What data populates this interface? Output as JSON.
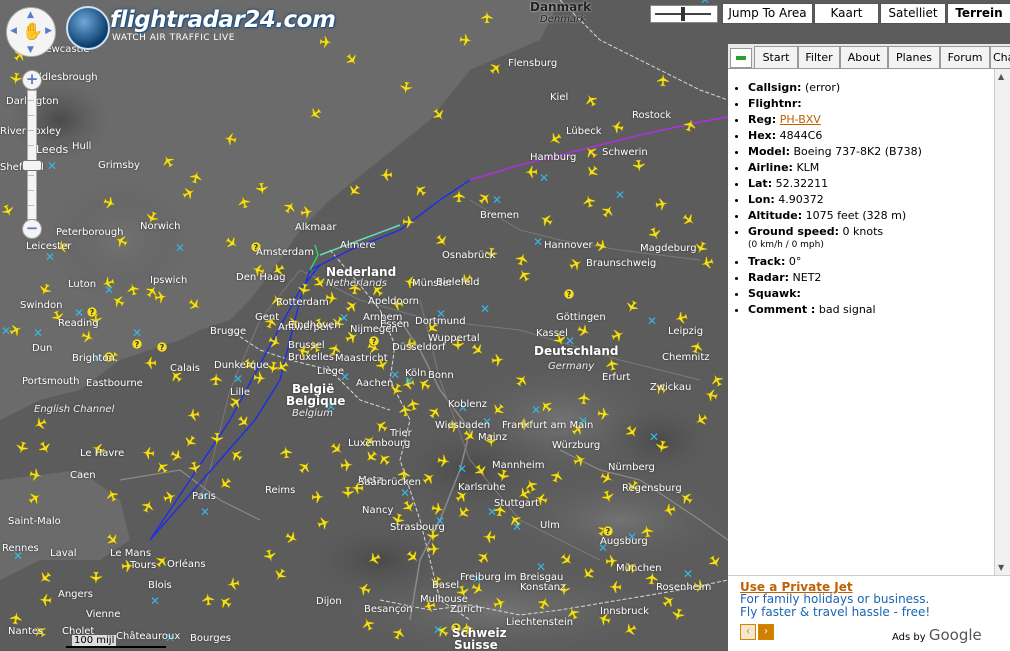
{
  "app": {
    "logo_text": "flightradar24.com",
    "tagline": "WATCH AIR TRAFFIC LIVE"
  },
  "controls": {
    "jump_label": "Jump To Area",
    "map_types": [
      "Kaart",
      "Satelliet",
      "Terrein"
    ],
    "active_map_type": "Terrein",
    "zoom_plus": "+",
    "zoom_minus": "−",
    "scale_label": "100 mijl"
  },
  "tabs": [
    "Start",
    "Filter",
    "About",
    "Planes",
    "Forum",
    "Chat"
  ],
  "flight": {
    "fields": [
      {
        "label": "Callsign:",
        "value": "(error)"
      },
      {
        "label": "Flightnr:",
        "value": ""
      },
      {
        "label": "Reg:",
        "value": "PH-BXV",
        "link": true
      },
      {
        "label": "Hex:",
        "value": "4844C6"
      },
      {
        "label": "Model:",
        "value": "Boeing 737-8K2 (B738)"
      },
      {
        "label": "Airline:",
        "value": "KLM"
      },
      {
        "label": "Lat:",
        "value": "52.32211"
      },
      {
        "label": "Lon:",
        "value": "4.90372"
      },
      {
        "label": "Altitude:",
        "value": "1075 feet (328 m)"
      },
      {
        "label": "Ground speed:",
        "value": "0 knots",
        "sub": "(0 km/h / 0 mph)"
      },
      {
        "label": "Track:",
        "value": "0°"
      },
      {
        "label": "Radar:",
        "value": "NET2"
      },
      {
        "label": "Squawk:",
        "value": ""
      },
      {
        "label": "Comment :",
        "value": "bad signal"
      }
    ]
  },
  "ad": {
    "title": "Use a Private Jet",
    "text": "For family holidays or business. Fly faster & travel hassle - free!",
    "by": "Ads by",
    "brand": "Google"
  },
  "colors": {
    "plane": "#f5e020",
    "track_blue": "#2030e0",
    "track_purple": "#b030e0",
    "track_cyan": "#60e0c0",
    "panel_link": "#c06000",
    "ad_text": "#1a66b0"
  },
  "map": {
    "countries": [
      "Nederland",
      "Netherlands",
      "België",
      "Belgique",
      "Belgium",
      "Luxembourg",
      "Deutschland",
      "Germany",
      "Danmark",
      "Denmark"
    ],
    "cities": [
      "Newcastle",
      "Middlesbrough",
      "Darlington",
      "River Loxley",
      "Leeds",
      "Sheffield",
      "Hull",
      "Grimsby",
      "Peterborough",
      "Norwich",
      "Ipswich",
      "Leicester",
      "Luton",
      "Swindon",
      "Dun",
      "Reading",
      "Brighton",
      "Portsmouth",
      "Eastbourne",
      "English Channel",
      "Le Havre",
      "Caen",
      "Saint-Malo",
      "Rennes",
      "Laval",
      "Le Mans",
      "Angers",
      "Nantes",
      "Cholet",
      "Vienne",
      "Tours",
      "Orléans",
      "Blois",
      "Châteauroux",
      "Bourges",
      "Paris",
      "Reims",
      "Lille",
      "Calais",
      "Dunkerque",
      "Brugge",
      "Gent",
      "Brussel",
      "Bruxelles",
      "Antwerpen",
      "Eindhoven",
      "Rotterdam",
      "Den Haag",
      "Amsterdam",
      "Alkmaar",
      "Almere",
      "Apeldoorn",
      "Arnhem",
      "Nijmegen",
      "Maastricht",
      "Liège",
      "Aachen",
      "Köln",
      "Bonn",
      "Essen",
      "Dortmund",
      "Wuppertal",
      "Düsseldorf",
      "Münster",
      "Osnabrück",
      "Bielefeld",
      "Bremen",
      "Hamburg",
      "Lübeck",
      "Kiel",
      "Flensburg",
      "Rostock",
      "Schwerin",
      "Hannover",
      "Braunschweig",
      "Magdeburg",
      "Göttingen",
      "Kassel",
      "Leipzig",
      "Chemnitz",
      "Zwickau",
      "Erfurt",
      "Frankfurt am Main",
      "Mainz",
      "Wiesbaden",
      "Koblenz",
      "Trier",
      "Luxembourg",
      "Metz",
      "Nancy",
      "Saarbrücken",
      "Mannheim",
      "Karlsruhe",
      "Stuttgart",
      "Nürnberg",
      "Regensburg",
      "Würzburg",
      "Strasbourg",
      "Freiburg im Breisgau",
      "Basel",
      "Zürich",
      "Konstanz",
      "Ulm",
      "Augsburg",
      "München",
      "Rosenheim",
      "Innsbruck",
      "Dijon",
      "Besançon",
      "Mulhouse",
      "Schweiz",
      "Suisse",
      "Liechtenstein"
    ]
  }
}
